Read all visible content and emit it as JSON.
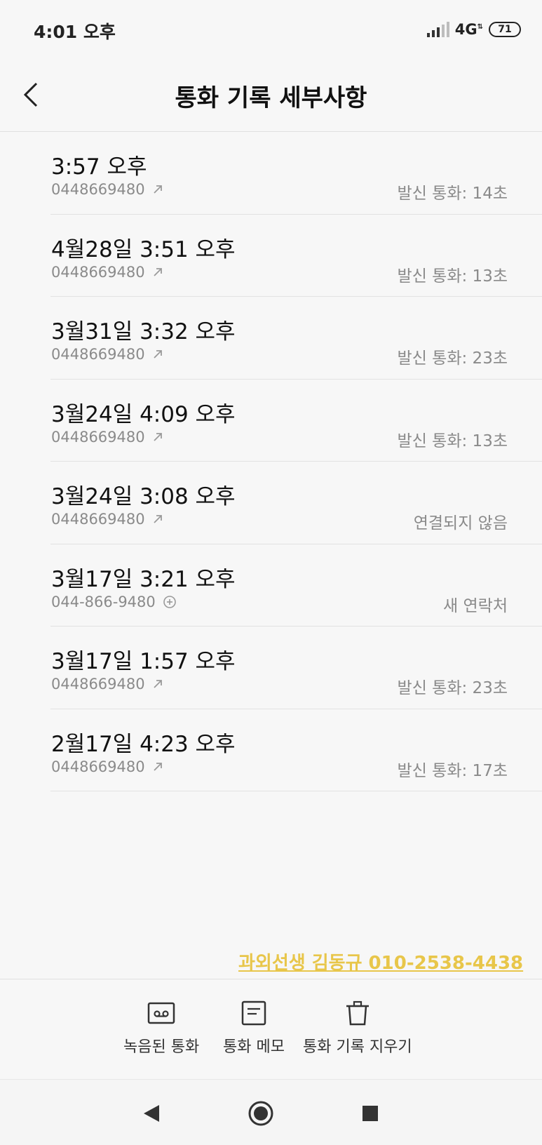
{
  "status_bar": {
    "time": "4:01 오후",
    "network": "4G",
    "battery": "71"
  },
  "header": {
    "title": "통화 기록 세부사항",
    "back_icon": "chevron-left-icon"
  },
  "calls": [
    {
      "time": "3:57 오후",
      "number": "0448669480",
      "status": "발신 통화: 14초",
      "icon": "outgoing-arrow-icon"
    },
    {
      "time": "4월28일 3:51 오후",
      "number": "0448669480",
      "status": "발신 통화: 13초",
      "icon": "outgoing-arrow-icon"
    },
    {
      "time": "3월31일 3:32 오후",
      "number": "0448669480",
      "status": "발신 통화: 23초",
      "icon": "outgoing-arrow-icon"
    },
    {
      "time": "3월24일 4:09 오후",
      "number": "0448669480",
      "status": "발신 통화: 13초",
      "icon": "outgoing-arrow-icon"
    },
    {
      "time": "3월24일 3:08 오후",
      "number": "0448669480",
      "status": "연결되지 않음",
      "icon": "outgoing-arrow-icon"
    },
    {
      "time": "3월17일 3:21 오후",
      "number": "044-866-9480",
      "status": "새 연락처",
      "icon": "add-contact-icon"
    },
    {
      "time": "3월17일 1:57 오후",
      "number": "0448669480",
      "status": "발신 통화: 23초",
      "icon": "outgoing-arrow-icon"
    },
    {
      "time": "2월17일 4:23 오후",
      "number": "0448669480",
      "status": "발신 통화: 17초",
      "icon": "outgoing-arrow-icon"
    }
  ],
  "watermark": "과외선생 김동규 010-2538-4438",
  "actions": {
    "recorded": "녹음된 통화",
    "memo": "통화 메모",
    "delete": "통화 기록 지우기"
  },
  "colors": {
    "background": "#f7f7f7",
    "watermark": "#e8c64a",
    "secondary_text": "#8a8a8a"
  }
}
